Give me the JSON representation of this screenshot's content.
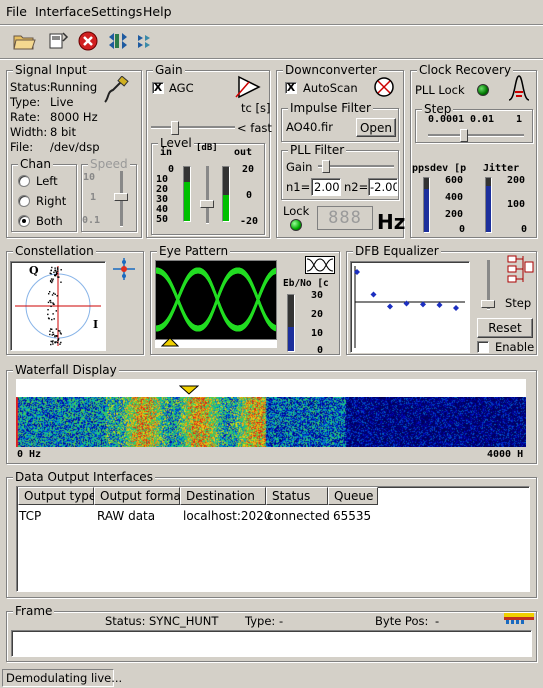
{
  "menu": {
    "file": "File",
    "interface": "Interface",
    "settings": "Settings",
    "help": "Help"
  },
  "signal_input": {
    "title": "Signal Input",
    "status_label": "Status:",
    "status_value": "Running",
    "type_label": "Type:",
    "type_value": "Live",
    "rate_label": "Rate:",
    "rate_value": "8000 Hz",
    "width_label": "Width:",
    "width_value": "8 bit",
    "file_label": "File:",
    "file_value": "/dev/dsp",
    "chan_title": "Chan",
    "chan_left": "Left",
    "chan_right": "Right",
    "chan_both": "Both",
    "speed_title": "Speed",
    "speed_scale": [
      "10",
      "1",
      "0.1"
    ]
  },
  "gain": {
    "title": "Gain",
    "agc_label": "AGC",
    "agc_checked": "X",
    "tc_label": "tc [s]",
    "fast_label": "< fast",
    "level_title": "Level",
    "in_label": "in",
    "db_label": "[dB]",
    "out_label": "out",
    "in_scale": [
      "0",
      "10",
      "20",
      "30",
      "40",
      "50"
    ],
    "out_scale": [
      "20",
      "0",
      "-20"
    ]
  },
  "downconverter": {
    "title": "Downconverter",
    "autoscan_label": "AutoScan",
    "autoscan_checked": "X",
    "impulse_title": "Impulse Filter",
    "impulse_file": "AO40.fir",
    "open_button": "Open",
    "pll_title": "PLL Filter",
    "gain_label": "Gain",
    "n1_label": "n1=",
    "n1_value": "2.00",
    "n2_label": "n2=",
    "n2_value": "-2.00",
    "lock_label": "Lock",
    "freq_display": "888",
    "hz_label": "Hz"
  },
  "clock_recovery": {
    "title": "Clock Recovery",
    "pll_lock_label": "PLL Lock",
    "step_title": "Step",
    "step_scale": [
      "0.0001",
      "0.01",
      "1"
    ],
    "ppsdev_label": "ppsdev [p",
    "jitter_label": "Jitter",
    "ppsdev_scale": [
      "600",
      "400",
      "200",
      "0"
    ],
    "jitter_scale": [
      "200",
      "100",
      "0"
    ]
  },
  "constellation": {
    "title": "Constellation",
    "q_label": "Q",
    "i_label": "I"
  },
  "eye_pattern": {
    "title": "Eye Pattern",
    "ebno_label": "Eb/No [c",
    "ebno_scale": [
      "30",
      "20",
      "10",
      "0"
    ]
  },
  "dfb_equalizer": {
    "title": "DFB Equalizer",
    "step_label": "Step",
    "reset_button": "Reset",
    "enable_label": "Enable",
    "taps": [
      1.0,
      0.25,
      -0.15,
      -0.05,
      -0.08,
      -0.1,
      -0.2
    ]
  },
  "waterfall": {
    "title": "Waterfall Display",
    "left_label": "0 Hz",
    "right_label": "4000 H"
  },
  "data_output": {
    "title": "Data Output Interfaces",
    "columns": [
      "Output type",
      "Output format",
      "Destination",
      "Status",
      "Queue"
    ],
    "rows": [
      [
        "TCP",
        "RAW data",
        "localhost:2020",
        "connected",
        "65535"
      ]
    ]
  },
  "frame": {
    "title": "Frame",
    "status_label": "Status:",
    "status_value": "SYNC_HUNT",
    "type_label": "Type:",
    "type_value": "-",
    "bytepos_label": "Byte Pos:",
    "bytepos_value": "-"
  },
  "statusbar": {
    "text": "Demodulating live..."
  },
  "colors": {
    "accent_green": "#00c000",
    "eye_green": "#22dd22",
    "meter_blue": "#1c2f9c"
  }
}
